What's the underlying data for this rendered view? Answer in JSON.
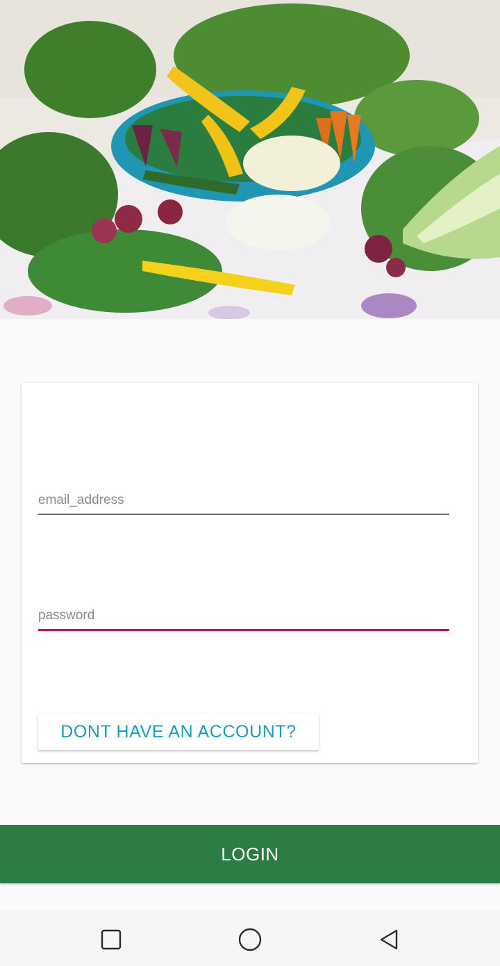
{
  "hero": {
    "image_name": "vegetables-photo"
  },
  "form": {
    "email_placeholder": "email_address",
    "email_value": "",
    "password_placeholder": "password",
    "password_value": "",
    "account_button_label": "DONT HAVE AN ACCOUNT?"
  },
  "actions": {
    "login_label": "LOGIN"
  },
  "navbar": {
    "recents_icon": "square-icon",
    "home_icon": "circle-icon",
    "back_icon": "triangle-back-icon"
  },
  "colors": {
    "primary_green": "#2d7b45",
    "accent_pink": "#c2185b",
    "link_blue": "#1a9bc0",
    "background": "#fafafa"
  }
}
